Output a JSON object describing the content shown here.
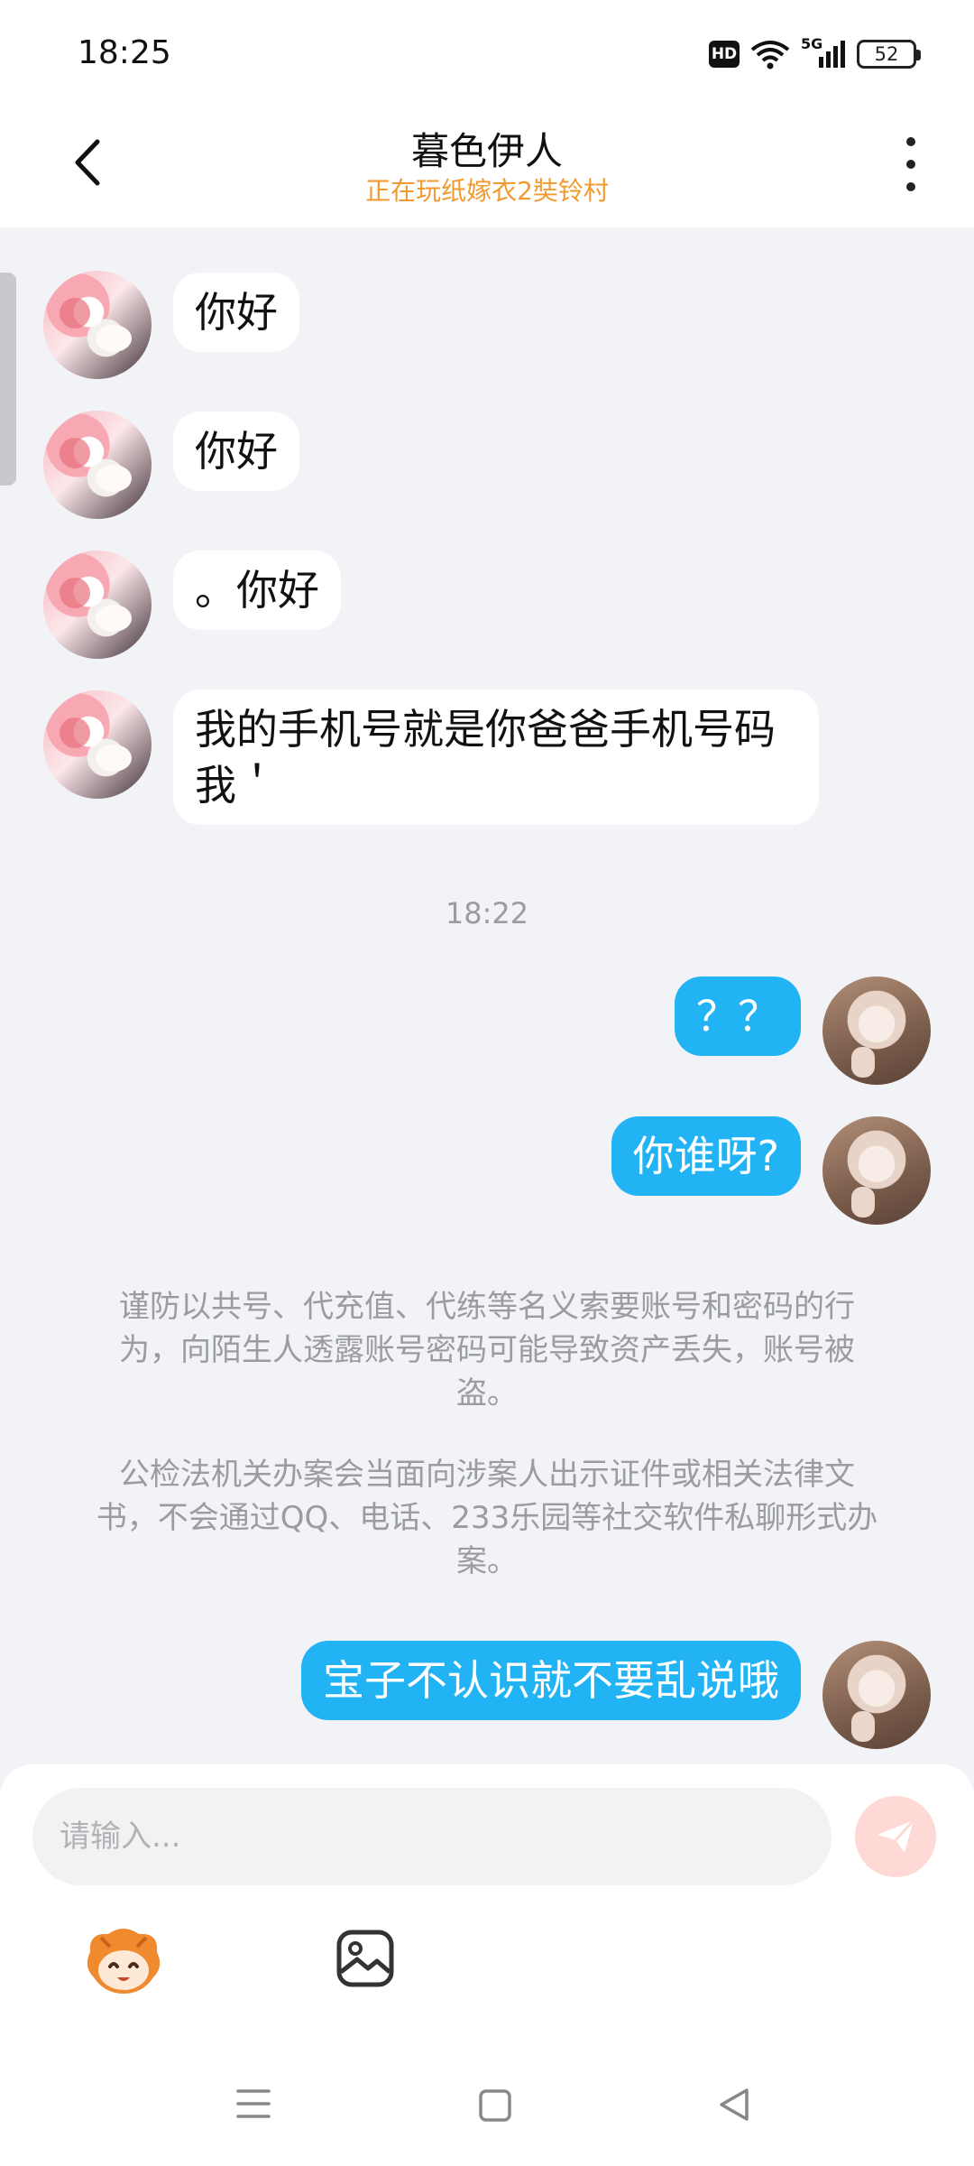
{
  "status_bar": {
    "time": "18:25",
    "hd_label": "HD",
    "network_label": "5G",
    "battery_level": "52"
  },
  "header": {
    "title": "暮色伊人",
    "subtitle": "正在玩纸嫁衣2奘铃村"
  },
  "messages": [
    {
      "from": "other",
      "text": "你好"
    },
    {
      "from": "other",
      "text": "你好"
    },
    {
      "from": "other",
      "text": "。你好"
    },
    {
      "from": "other",
      "text": "我的手机号就是你爸爸手机号码\n我＇"
    },
    {
      "from": "self",
      "text": "？？"
    },
    {
      "from": "self",
      "text": "你谁呀?"
    },
    {
      "from": "self",
      "text": "宝子不认识就不要乱说哦"
    }
  ],
  "time_separator": "18:22",
  "notices": [
    "谨防以共号、代充值、代练等名义索要账号和密码的行为，向陌生人透露账号密码可能导致资产丢失，账号被盗。",
    "公检法机关办案会当面向涉案人出示证件或相关法律文书，不会通过QQ、电话、233乐园等社交软件私聊形式办案。"
  ],
  "input": {
    "placeholder": "请输入..."
  },
  "icons": {
    "back": "chevron-left-icon",
    "more": "more-vertical-icon",
    "send": "paper-plane-icon",
    "emoji": "mascot-emoji-icon",
    "image": "image-icon"
  },
  "colors": {
    "accent_subtitle": "#f19a2f",
    "bubble_out": "#22b3f5",
    "send_disabled": "#ffd9d6"
  }
}
